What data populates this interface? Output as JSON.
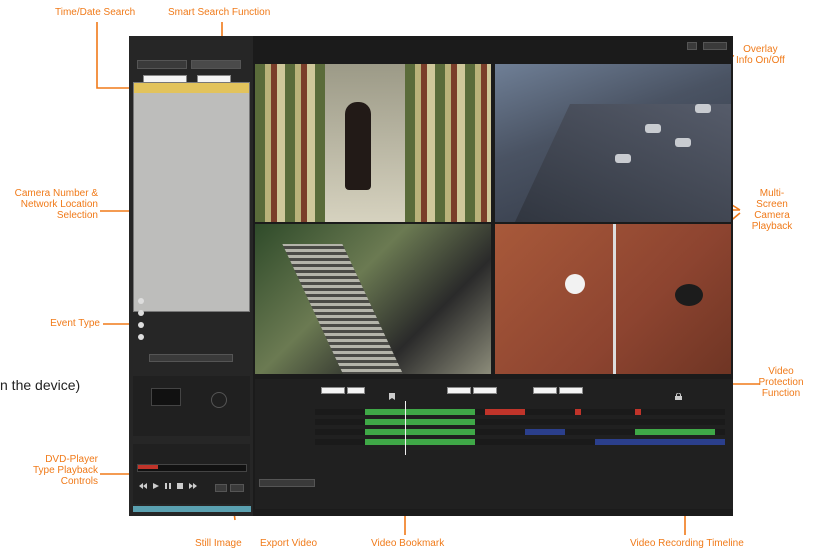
{
  "annotations": {
    "time_date_search": "Time/Date Search",
    "smart_search": "Smart Search Function",
    "overlay": [
      "Overlay",
      "Info On/Off"
    ],
    "camera_selection": [
      "Camera Number &",
      "Network Location",
      "Selection"
    ],
    "multi_screen": [
      "Multi-",
      "Screen",
      "Camera",
      "Playback"
    ],
    "event_type": "Event Type",
    "device_text": "n the device)",
    "video_protection": [
      "Video",
      "Protection",
      "Function"
    ],
    "dvd_controls": [
      "DVD-Player",
      "Type Playback",
      "Controls"
    ],
    "still_image": "Still Image",
    "export_video": "Export Video",
    "video_bookmark": "Video Bookmark",
    "recording_timeline": "Video Recording Timeline"
  },
  "colors": {
    "annotation": "#f07a19",
    "app_bg": "#1b1b1b",
    "selected_row": "#e2c35c",
    "record_green": "#3fa847",
    "event_red": "#c0342a",
    "motion_blue": "#2b3f8c"
  },
  "icons": [
    "calendar-icon",
    "camera-icon",
    "folder-icon",
    "play-icon",
    "pause-icon",
    "stop-icon",
    "rewind-icon",
    "fast-forward-icon",
    "lock-icon",
    "overlay-icon",
    "bookmark-icon"
  ]
}
